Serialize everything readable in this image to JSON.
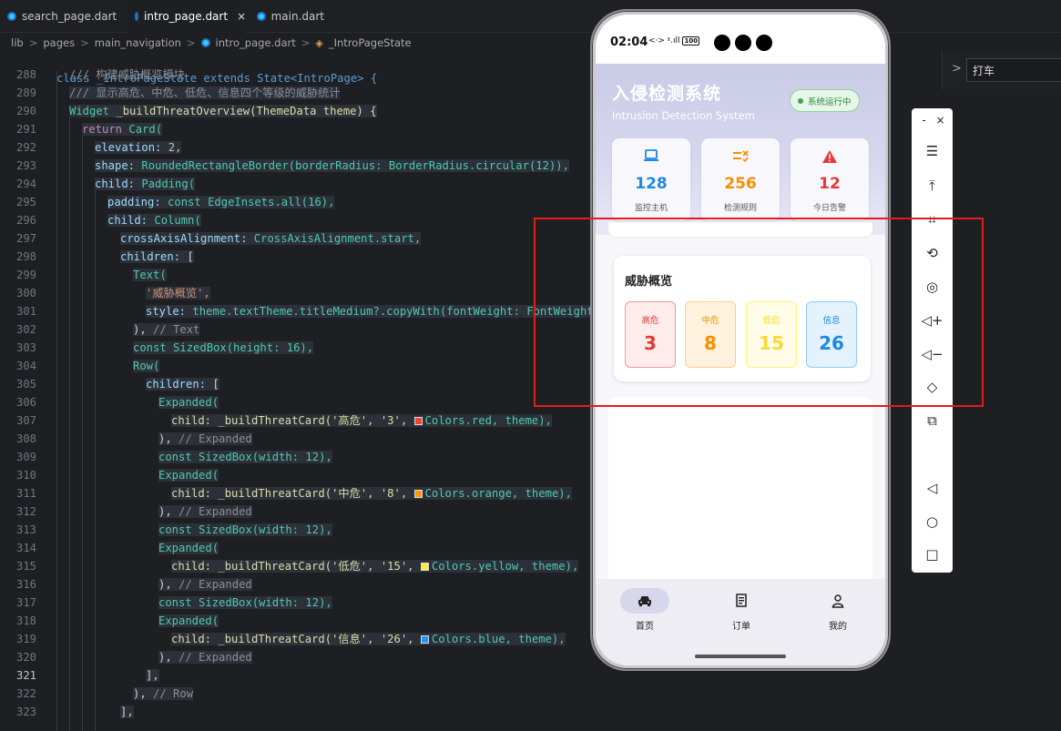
{
  "tabs": [
    {
      "label": "search_page.dart"
    },
    {
      "label": "intro_page.dart",
      "close": "×"
    },
    {
      "label": "main.dart"
    }
  ],
  "breadcrumb": [
    "lib",
    "pages",
    "main_navigation",
    "intro_page.dart",
    "_IntroPageState"
  ],
  "breadcrumb_sep": ">",
  "code_header": "class _IntroPageState extends State<IntroPage> {",
  "line_numbers": [
    "288",
    "289",
    "290",
    "291",
    "292",
    "293",
    "294",
    "295",
    "296",
    "297",
    "298",
    "299",
    "300",
    "301",
    "302",
    "303",
    "304",
    "305",
    "306",
    "307",
    "308",
    "309",
    "310",
    "311",
    "312",
    "313",
    "314",
    "315",
    "316",
    "317",
    "318",
    "319",
    "320",
    "321",
    "322",
    "323"
  ],
  "code": {
    "l288": "/// 构建威胁概览模块",
    "l289": "/// 显示高危、中危、低危、信息四个等级的威胁统计",
    "l290_a": "Widget",
    "l290_b": "_buildThreatOverview(ThemeData theme) {",
    "l291_a": "return",
    "l291_b": "Card(",
    "l292_a": "elevation:",
    "l292_b": "2,",
    "l293_a": "shape:",
    "l293_b": "RoundedRectangleBorder(borderRadius: BorderRadius.circular(12)),",
    "l294_a": "child:",
    "l294_b": "Padding(",
    "l295_a": "padding:",
    "l295_b": "const EdgeInsets.all(16),",
    "l296_a": "child:",
    "l296_b": "Column(",
    "l297_a": "crossAxisAlignment:",
    "l297_b": "CrossAxisAlignment.start,",
    "l298_a": "children:",
    "l298_b": "[",
    "l299": "Text(",
    "l300": "'威胁概览',",
    "l301_a": "style:",
    "l301_b": "theme.textTheme.titleMedium?.copyWith(fontWeight: FontWeight.",
    "l302_a": "),",
    "l302_b": "// Text",
    "l303": "const SizedBox(height: 16),",
    "l304": "Row(",
    "l305_a": "children:",
    "l305_b": "[",
    "l306": "Expanded(",
    "l307_a": "child: _buildThreatCard('高危', '3',",
    "l307_b": "Colors.red, theme),",
    "l308_a": "),",
    "l308_b": "// Expanded",
    "l309": "const SizedBox(width: 12),",
    "l310": "Expanded(",
    "l311_a": "child: _buildThreatCard('中危', '8',",
    "l311_b": "Colors.orange, theme),",
    "l312_a": "),",
    "l312_b": "// Expanded",
    "l313": "const SizedBox(width: 12),",
    "l314": "Expanded(",
    "l315_a": "child: _buildThreatCard('低危', '15',",
    "l315_b": "Colors.yellow, theme),",
    "l316_a": "),",
    "l316_b": "// Expanded",
    "l317": "const SizedBox(width: 12),",
    "l318": "Expanded(",
    "l319_a": "child: _buildThreatCard('信息', '26',",
    "l319_b": "Colors.blue, theme),",
    "l320_a": "),",
    "l320_b": "// Expanded",
    "l321": "],",
    "l322_a": "),",
    "l322_b": "// Row",
    "l323": "],"
  },
  "swatches": {
    "red": "#f44336",
    "orange": "#ff9800",
    "yellow": "#ffeb3b",
    "blue": "#2196f3"
  },
  "side_search": {
    "chevron": ">",
    "value": "打车"
  },
  "phone": {
    "time": "02:04",
    "status_icons": "<·> ᵡ.ıll",
    "battery": "100",
    "app_title": "入侵检测系统",
    "app_subtitle": "Intrusion Detection System",
    "system_status": "系统运行中",
    "stats": [
      {
        "icon": "laptop-icon",
        "value": "128",
        "label": "监控主机",
        "color": "#1e88e5"
      },
      {
        "icon": "rules-icon",
        "value": "256",
        "label": "检测规则",
        "color": "#fb8c00"
      },
      {
        "icon": "warning-icon",
        "value": "12",
        "label": "今日告警",
        "color": "#e53935"
      }
    ],
    "threat_overview": {
      "title": "威胁概览",
      "items": [
        {
          "label": "高危",
          "value": "3"
        },
        {
          "label": "中危",
          "value": "8"
        },
        {
          "label": "低危",
          "value": "15"
        },
        {
          "label": "信息",
          "value": "26"
        }
      ]
    },
    "nav": [
      {
        "label": "首页",
        "icon": "car-icon",
        "active": true
      },
      {
        "label": "订单",
        "icon": "receipt-icon",
        "active": false
      },
      {
        "label": "我的",
        "icon": "person-icon",
        "active": false
      }
    ]
  },
  "emulator_toolbar": {
    "minimize": "-",
    "close": "×"
  }
}
